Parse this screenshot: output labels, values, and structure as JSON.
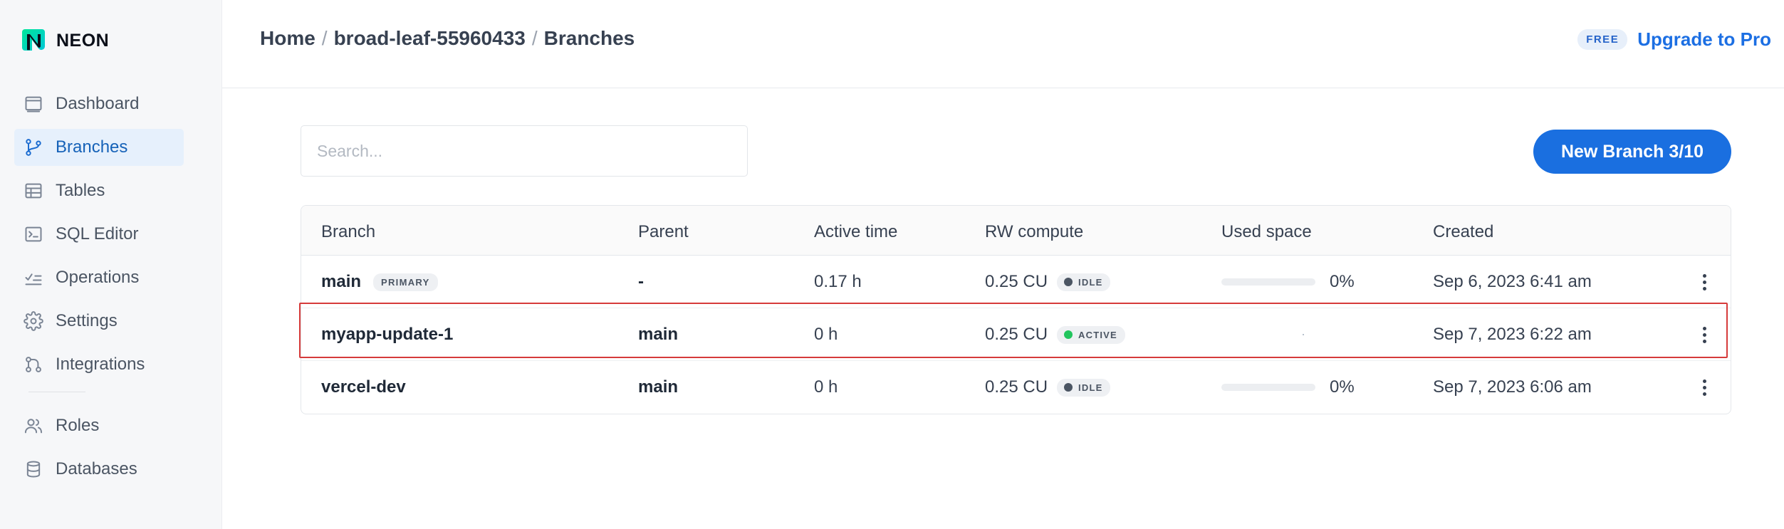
{
  "app": {
    "logo_text": "NEON"
  },
  "sidebar": {
    "items": [
      {
        "label": "Dashboard",
        "icon": "dashboard-icon",
        "active": false
      },
      {
        "label": "Branches",
        "icon": "branch-icon",
        "active": true
      },
      {
        "label": "Tables",
        "icon": "table-icon",
        "active": false
      },
      {
        "label": "SQL Editor",
        "icon": "sql-editor-icon",
        "active": false
      },
      {
        "label": "Operations",
        "icon": "operations-icon",
        "active": false
      },
      {
        "label": "Settings",
        "icon": "gear-icon",
        "active": false
      },
      {
        "label": "Integrations",
        "icon": "integrations-icon",
        "active": false
      }
    ],
    "items_secondary": [
      {
        "label": "Roles",
        "icon": "users-icon"
      },
      {
        "label": "Databases",
        "icon": "database-icon"
      }
    ]
  },
  "header": {
    "breadcrumb": [
      "Home",
      "broad-leaf-55960433",
      "Branches"
    ],
    "plan_badge": "FREE",
    "upgrade_label": "Upgrade to Pro"
  },
  "toolbar": {
    "search_placeholder": "Search...",
    "new_branch_label": "New Branch 3/10"
  },
  "table": {
    "columns": [
      "Branch",
      "Parent",
      "Active time",
      "RW compute",
      "Used space",
      "Created"
    ],
    "rows": [
      {
        "branch": "main",
        "tag": "PRIMARY",
        "parent": "-",
        "active_time": "0.17 h",
        "compute": "0.25 CU",
        "status": "IDLE",
        "used_percent": 0,
        "used_label": "0%",
        "created": "Sep 6, 2023 6:41 am"
      },
      {
        "branch": "myapp-update-1",
        "tag": "",
        "parent": "main",
        "active_time": "0 h",
        "compute": "0.25 CU",
        "status": "ACTIVE",
        "used_percent": null,
        "used_label": "",
        "created": "Sep 7, 2023 6:22 am"
      },
      {
        "branch": "vercel-dev",
        "tag": "",
        "parent": "main",
        "active_time": "0 h",
        "compute": "0.25 CU",
        "status": "IDLE",
        "used_percent": 0,
        "used_label": "0%",
        "created": "Sep 7, 2023 6:06 am"
      }
    ]
  },
  "colors": {
    "accent": "#1a6fe0",
    "active_nav_bg": "#e6f0fc",
    "status_idle": "#4b5563",
    "status_active": "#22c55e",
    "logo_green": "#00e599",
    "highlight": "#d63b3b"
  }
}
